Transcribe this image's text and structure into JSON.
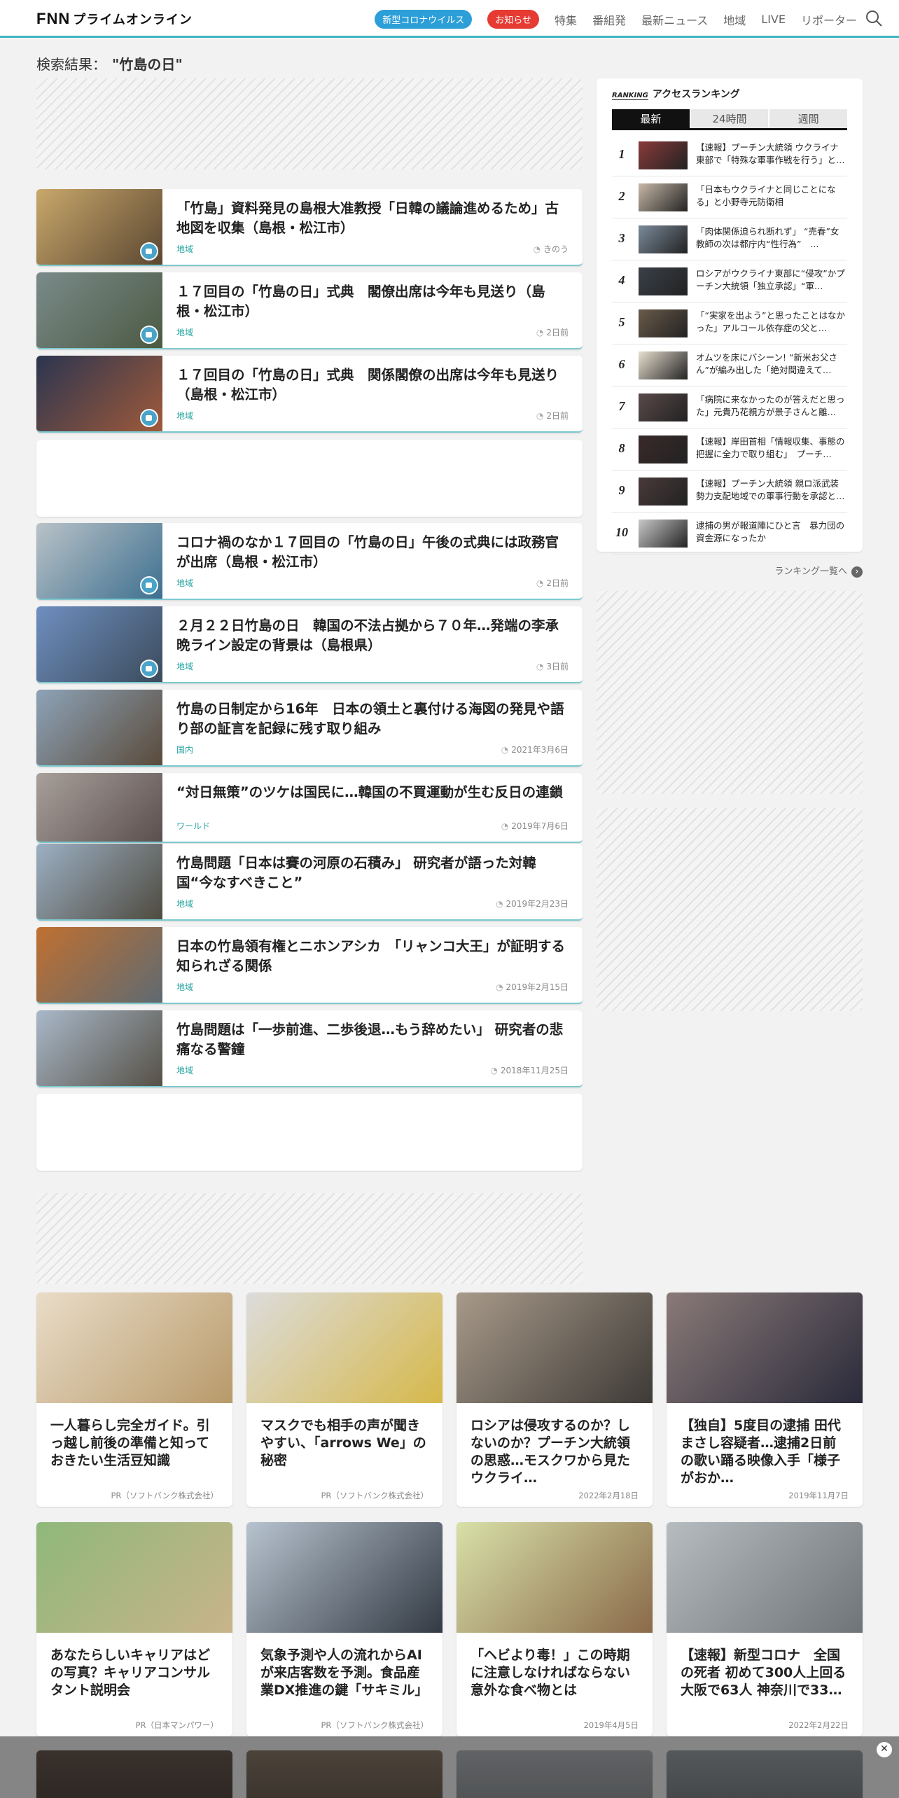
{
  "header": {
    "logo": "FNN",
    "logo_sub": "プライムオンライン",
    "pill_corona": "新型コロナウイルス",
    "pill_notice": "お知らせ",
    "nav": [
      "特集",
      "番組発",
      "最新ニュース",
      "地域",
      "LIVE",
      "リポーター"
    ]
  },
  "search": {
    "label": "検索結果：",
    "query": "\"竹島の日\""
  },
  "articles": [
    {
      "title": "「竹島」資料発見の島根大准教授「日韓の議論進めるため」古地図を収集（島根・松江市）",
      "category": "地域",
      "date": "きのう",
      "colors": [
        "#c9a86a",
        "#5a4632"
      ]
    },
    {
      "title": "１７回目の「竹島の日」式典　閣僚出席は今年も見送り（島根・松江市）",
      "category": "地域",
      "date": "2日前",
      "colors": [
        "#7a8a8a",
        "#4b5a42"
      ]
    },
    {
      "title": "１７回目の「竹島の日」式典　関係閣僚の出席は今年も見送り（島根・松江市）",
      "category": "地域",
      "date": "2日前",
      "colors": [
        "#2b3550",
        "#a05a3a"
      ]
    },
    {
      "title": "コロナ禍のなか１７回目の「竹島の日」午後の式典には政務官が出席（島根・松江市）",
      "category": "地域",
      "date": "2日前",
      "colors": [
        "#b9c2c7",
        "#3d6f8f"
      ]
    },
    {
      "title": "２月２２日竹島の日　韓国の不法占拠から７０年…発端の李承晩ライン設定の背景は（島根県）",
      "category": "地域",
      "date": "3日前",
      "colors": [
        "#6f8fc0",
        "#3a4a5a"
      ]
    },
    {
      "title": "竹島の日制定から16年　日本の領土と裏付ける海図の発見や語り部の証言を記録に残す取り組み",
      "category": "国内",
      "date": "2021年3月6日",
      "colors": [
        "#8da3b8",
        "#5a4a3a"
      ]
    },
    {
      "title": "“対日無策”のツケは国民に…韓国の不買運動が生む反日の連鎖",
      "category": "ワールド",
      "date": "2019年7月6日",
      "colors": [
        "#a8a09a",
        "#5b4e4e"
      ]
    },
    {
      "title": "竹島問題「日本は賽の河原の石積み」 研究者が語った対韓国“今なすべきこと”",
      "category": "地域",
      "date": "2019年2月23日",
      "colors": [
        "#9cb0c4",
        "#4e4a3e"
      ]
    },
    {
      "title": "日本の竹島領有権とニホンアシカ　「リャンコ大王」が証明する知られざる関係",
      "category": "地域",
      "date": "2019年2月15日",
      "colors": [
        "#c07030",
        "#5e6a72"
      ]
    },
    {
      "title": "竹島問題は「一歩前進、二歩後退…もう辞めたい」 研究者の悲痛なる警鐘",
      "category": "地域",
      "date": "2018年11月25日",
      "colors": [
        "#a9b8c9",
        "#555045"
      ]
    }
  ],
  "ranking": {
    "badge": "RANKING",
    "title": "アクセスランキング",
    "tabs": [
      "最新",
      "24時間",
      "週間"
    ],
    "items": [
      {
        "num": "1",
        "text": "【速報】プーチン大統領 ウクライナ東部で「特殊な軍事作戦を行う」と…"
      },
      {
        "num": "2",
        "text": "「日本もウクライナと同じことになる」と小野寺元防衛相"
      },
      {
        "num": "3",
        "text": "「肉体関係迫られ断れず」 “売春”女教師の次は都庁内“性行為”　…"
      },
      {
        "num": "4",
        "text": "ロシアがウクライナ東部に“侵攻”かプーチン大統領「独立承認」“軍…"
      },
      {
        "num": "5",
        "text": "「“実家を出よう”と思ったことはなかった」アルコール依存症の父と…"
      },
      {
        "num": "6",
        "text": "オムツを床にバシーン! “新米お父さん”が編み出した「絶対間違えて…"
      },
      {
        "num": "7",
        "text": "「病院に来なかったのが答えだと思った」元貴乃花親方が景子さんと離…"
      },
      {
        "num": "8",
        "text": "【速報】岸田首相「情報収集、事態の把握に全力で取り組む」　プーチ…"
      },
      {
        "num": "9",
        "text": "【速報】プーチン大統領 親ロ派武装勢力支配地域での軍事行動を承認と…"
      },
      {
        "num": "10",
        "text": "逮捕の男が報道陣にひと言　暴力団の資金源になったか"
      }
    ],
    "more": "ランキング一覧へ"
  },
  "pr": [
    {
      "title": "一人暮らし完全ガイド。引っ越し前後の準備と知っておきたい生活豆知識",
      "source": "PR（ソフトバンク株式会社）",
      "colors": [
        "#e9dcc8",
        "#b89a6a"
      ]
    },
    {
      "title": "マスクでも相手の声が聞きやすい、「arrows We」の秘密",
      "source": "PR（ソフトバンク株式会社）",
      "colors": [
        "#dcdcdc",
        "#d6b84a"
      ]
    },
    {
      "title": "ロシアは侵攻するのか？しないのか？プーチン大統領の思惑…モスクワから見たウクライ…",
      "source": "2022年2月18日",
      "colors": [
        "#a89a8a",
        "#3e3a36"
      ]
    },
    {
      "title": "【独自】5度目の逮捕 田代まさし容疑者…逮捕2日前の歌い踊る映像入手「様子がおか…",
      "source": "2019年11月7日",
      "colors": [
        "#8a7a78",
        "#2a2a3a"
      ]
    },
    {
      "title": "あなたらしいキャリアはどの写真？キャリアコンサルタント説明会",
      "source": "PR（日本マンパワー）",
      "colors": [
        "#8fb87a",
        "#c9b48a"
      ]
    },
    {
      "title": "気象予測や人の流れからAIが来店客数を予測。食品産業DX推進の鍵「サキミル」",
      "source": "PR（ソフトバンク株式会社）",
      "colors": [
        "#b7c3cf",
        "#333a44"
      ]
    },
    {
      "title": "「ヘビより毒！」この時期に注意しなければならない意外な食べ物とは",
      "source": "2019年4月5日",
      "colors": [
        "#d8e0a8",
        "#8a6a4a"
      ]
    },
    {
      "title": "【速報】新型コロナ　全国の死者 初めて300人上回る 大阪で63人 神奈川で33…",
      "source": "2022年2月22日",
      "colors": [
        "#b6bcc0",
        "#6e7478"
      ]
    }
  ]
}
